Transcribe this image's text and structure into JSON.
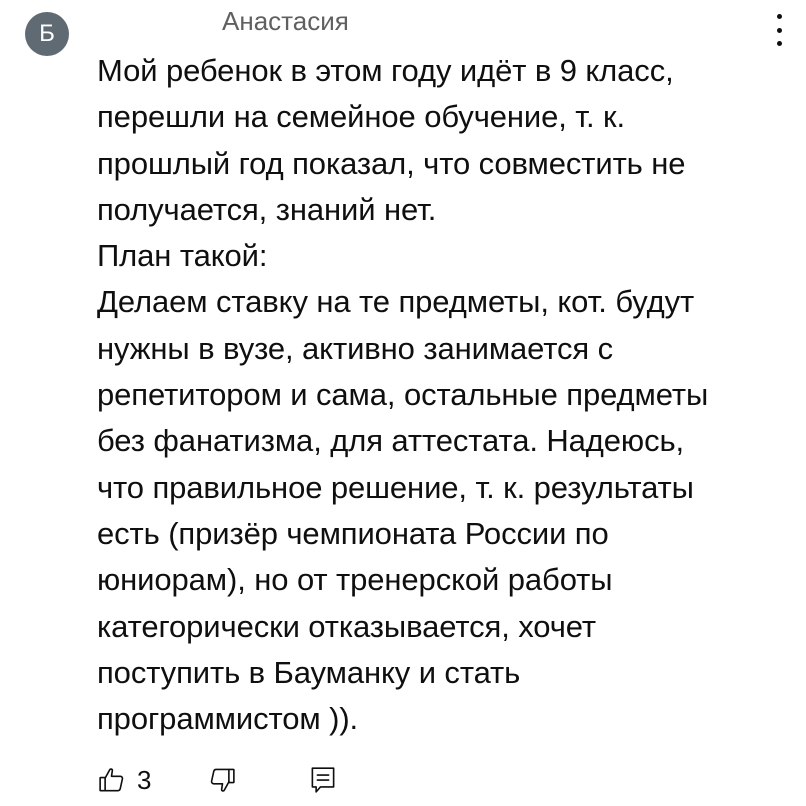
{
  "comment": {
    "avatar_letter": "Б",
    "avatar_color": "#5f6a72",
    "author": "Анастасия",
    "lines": [
      "Мой ребенок в этом году идёт в 9 класс,",
      "перешли на семейное обучение, т. к.",
      "прошлый год показал, что совместить не",
      "получается, знаний нет.",
      "План такой:",
      "Делаем ставку на те предметы, кот. будут",
      "нужны в вузе, активно занимается с",
      "репетитором и сама, остальные предметы",
      "без фанатизма, для аттестата. Надеюсь,",
      "что правильное решение, т. к. результаты",
      "есть (призёр чемпионата России по",
      "юниорам), но от тренерской работы",
      "категорически отказывается, хочет",
      "поступить в Бауманку и стать",
      "программистом ))."
    ],
    "like_count": "3"
  },
  "icons": {
    "menu": "more-vert-icon",
    "like": "thumb-up-icon",
    "dislike": "thumb-down-icon",
    "reply": "reply-comment-icon"
  }
}
